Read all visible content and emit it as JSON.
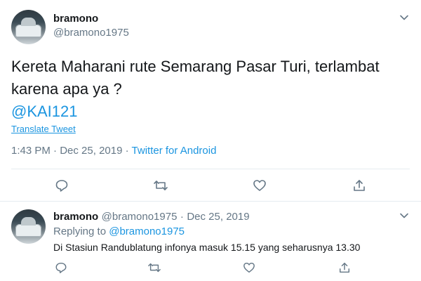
{
  "main_tweet": {
    "name": "bramono",
    "handle": "@bramono1975",
    "text_line1": "Kereta Maharani rute Semarang Pasar Turi, terlambat",
    "text_line2": "karena apa ya  ?",
    "mention": "@KAI121",
    "translate_label": "Translate Tweet",
    "time": "1:43 PM",
    "date": "Dec 25, 2019",
    "separator": "·",
    "source": "Twitter for Android",
    "icons": [
      "reply-icon",
      "retweet-icon",
      "like-icon",
      "share-icon"
    ]
  },
  "reply_tweet": {
    "name": "bramono",
    "handle": "@bramono1975",
    "separator": "·",
    "date": "Dec 25, 2019",
    "replying_to_label": "Replying to",
    "replying_to_handle": "@bramono1975",
    "text": "Di Stasiun Randublatung infonya masuk 15.15 yang seharusnya 13.30",
    "icons": [
      "reply-icon",
      "retweet-icon",
      "like-icon",
      "share-icon"
    ]
  },
  "colors": {
    "link": "#1b95e0",
    "secondary": "#657786",
    "primary_text": "#14171a",
    "divider": "#e6ecf0"
  }
}
